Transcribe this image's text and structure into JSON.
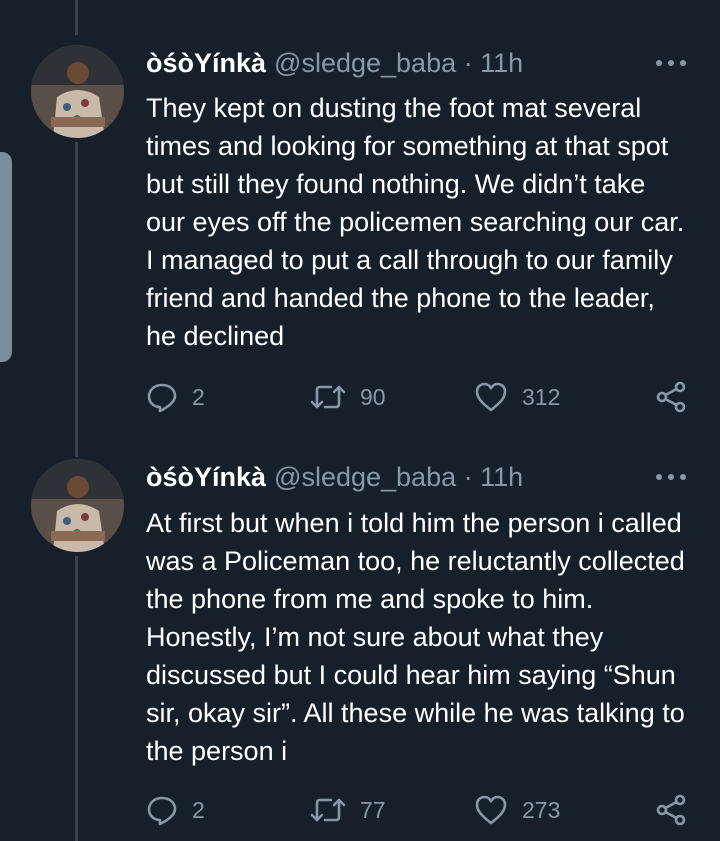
{
  "tweets": [
    {
      "name": "òśòYínkà",
      "handle": "@sledge_baba · 11h",
      "text": "They kept on dusting the foot mat several times and looking for something at that spot but still they found nothing. We didn’t take our eyes off the policemen searching our car. I managed to put a call through to our family friend and handed the phone to the leader, he declined",
      "replies": "2",
      "retweets": "90",
      "likes": "312"
    },
    {
      "name": "òśòYínkà",
      "handle": "@sledge_baba · 11h",
      "text": "At first but when i told him the person i called was a Policeman too, he reluctantly collected the phone from me and spoke to him. Honestly, I’m not sure about what they discussed but I could hear him saying “Shun sir, okay sir”. All these while he was talking to the person i",
      "replies": "2",
      "retweets": "77",
      "likes": "273"
    }
  ],
  "colors": {
    "background": "#15202b",
    "muted": "#8899a6",
    "text": "#ffffff",
    "thread": "#38444d"
  },
  "icons": [
    "reply-icon",
    "retweet-icon",
    "like-icon",
    "share-icon",
    "more-icon"
  ]
}
